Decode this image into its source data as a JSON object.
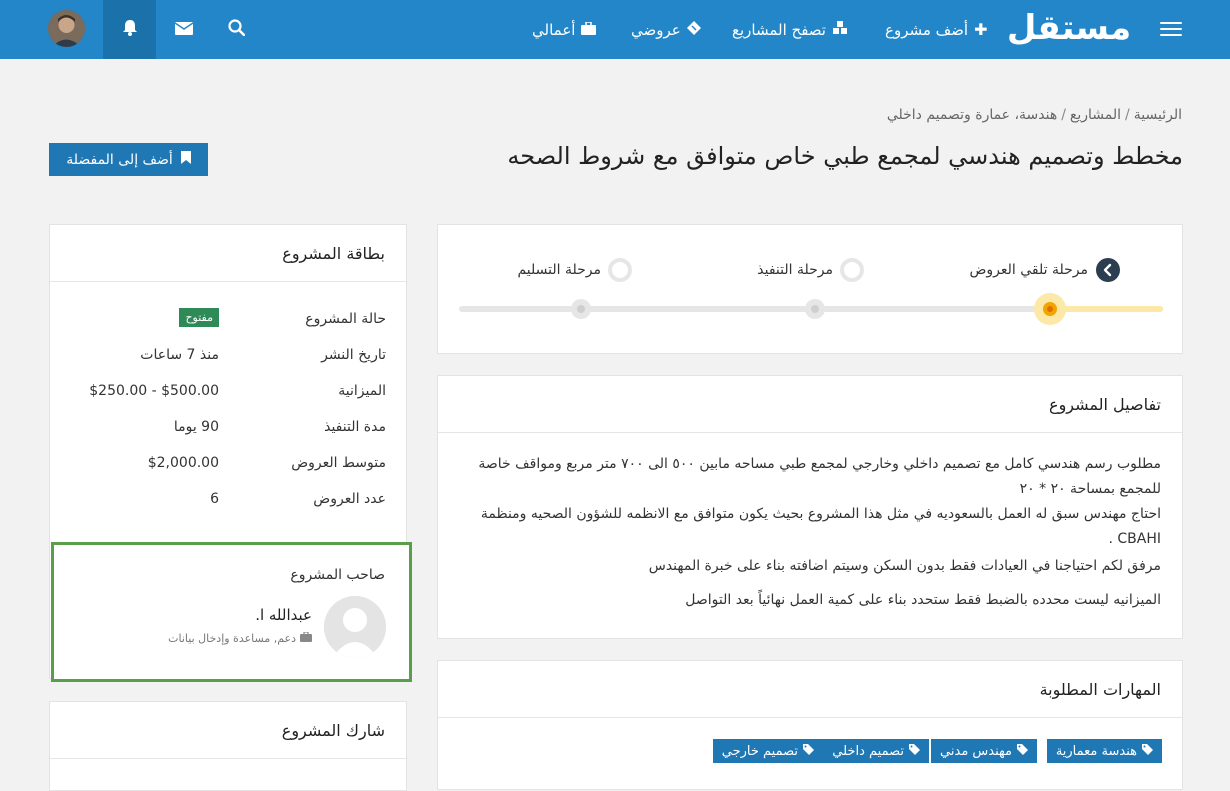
{
  "nav": {
    "logo": "مستقل",
    "add_project": "أضف مشروع",
    "browse_projects": "تصفح المشاريع",
    "my_offers": "عروضي",
    "my_works": "أعمالي"
  },
  "breadcrumb": {
    "home": "الرئيسية",
    "projects": "المشاريع",
    "category": "هندسة، عمارة وتصميم داخلي"
  },
  "page": {
    "title": "مخطط وتصميم هندسي لمجمع طبي خاص متوافق مع شروط الصحه",
    "favorite_button": "أضف إلى المفضلة"
  },
  "stages": {
    "receiving_offers": "مرحلة تلقي العروض",
    "execution": "مرحلة التنفيذ",
    "delivery": "مرحلة التسليم",
    "current_index": 0
  },
  "project_card": {
    "title": "بطاقة المشروع",
    "status_label": "حالة المشروع",
    "status_value": "مفتوح",
    "published_label": "تاريخ النشر",
    "published_value": "منذ 7 ساعات",
    "budget_label": "الميزانية",
    "budget_value": "$250.00 - $500.00",
    "duration_label": "مدة التنفيذ",
    "duration_value": "90 يوما",
    "avg_offers_label": "متوسط العروض",
    "avg_offers_value": "$2,000.00",
    "offers_count_label": "عدد العروض",
    "offers_count_value": "6"
  },
  "owner": {
    "title": "صاحب المشروع",
    "name": "عبدالله ا.",
    "subtitle": "دعم, مساعدة وإدخال بيانات"
  },
  "share": {
    "title": "شارك المشروع"
  },
  "details": {
    "title": "تفاصيل المشروع",
    "lines": [
      "مطلوب رسم هندسي كامل مع تصميم داخلي وخارجي لمجمع طبي مساحه مابين ٥٠٠ الى ٧٠٠ متر مربع ومواقف خاصة للمجمع بمساحة ٢٠ * ٢٠",
      "احتاج مهندس سبق له العمل بالسعوديه في مثل هذا المشروع بحيث يكون متوافق مع الانظمه للشؤون الصحيه ومنظمة CBAHI .",
      "مرفق لكم احتياجنا في العيادات فقط بدون السكن وسيتم اضافته بناء على خبرة المهندس",
      "الميزانيه ليست محدده بالضبط فقط ستحدد بناء على كمية العمل نهائياً بعد التواصل"
    ]
  },
  "skills": {
    "title": "المهارات المطلوبة",
    "items": [
      "هندسة معمارية",
      "مهندس مدني",
      "تصميم داخلي",
      "تصميم خارجي"
    ]
  },
  "colors": {
    "navbar": "#2386c8",
    "primary_button": "#1f78b4",
    "open_badge": "#2e8b57",
    "active_stage": "#f0a500",
    "owner_border": "#5a9e4a"
  }
}
